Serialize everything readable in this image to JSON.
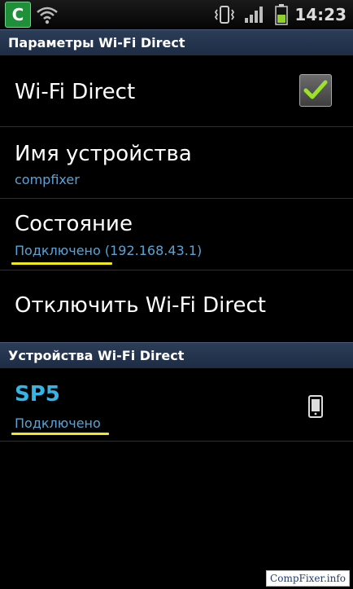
{
  "status_bar": {
    "app_badge": "C",
    "time": "14:23"
  },
  "wifi_direct_settings": {
    "header": "Параметры Wi-Fi Direct",
    "toggle_label": "Wi-Fi Direct",
    "toggle_checked": true,
    "device_name_label": "Имя устройства",
    "device_name_value": "compfixer",
    "status_label": "Состояние",
    "status_value": "Подключено (192.168.43.1)",
    "disconnect_label": "Отключить Wi-Fi Direct"
  },
  "devices_section": {
    "header": "Устройства Wi-Fi Direct",
    "devices": [
      {
        "name": "SP5",
        "status": "Подключено",
        "icon": "phone-icon"
      }
    ]
  },
  "watermark": "CompFixer.info",
  "colors": {
    "header_bg": "#243552",
    "accent_blue": "#33b5e5",
    "subtext_blue": "#5aa3d6",
    "highlight_yellow": "#f2ea12",
    "check_green": "#9be22d"
  }
}
